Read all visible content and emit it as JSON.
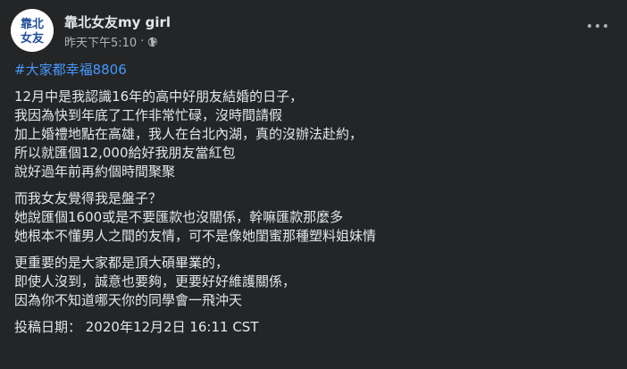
{
  "header": {
    "page_name": "靠北女友my girl",
    "timestamp": "昨天下午5:10",
    "separator": "·",
    "privacy_icon": "globe-icon",
    "avatar_text": [
      "靠北",
      "女友"
    ],
    "more_icon": "more-horizontal-icon"
  },
  "post": {
    "hashtag": "#大家都幸福8806",
    "paragraphs": [
      [
        "12月中是我認識16年的高中好朋友結婚的日子，",
        "我因為快到年底了工作非常忙碌，沒時間請假",
        "加上婚禮地點在高雄，我人在台北內湖，真的沒辦法赴約，",
        "所以就匯個12,000給好我朋友當紅包",
        "說好過年前再約個時間聚聚"
      ],
      [
        "而我女友覺得我是盤子？",
        "她說匯個1600或是不要匯款也沒關係，幹嘛匯款那麼多",
        "她根本不懂男人之間的友情，可不是像她閨蜜那種塑料姐妹情"
      ],
      [
        "更重要的是大家都是頂大碩畢業的，",
        "即使人沒到，誠意也要夠，更要好好維護關係，",
        "因為你不知道哪天你的同學會一飛沖天"
      ]
    ],
    "posted_date": "投稿日期： 2020年12月2日 16:11 CST"
  },
  "colors": {
    "background": "#242526",
    "text_primary": "#e4e6eb",
    "text_secondary": "#b0b3b8",
    "hashtag": "#4599ff",
    "avatar_text": "#1f4f9a"
  }
}
